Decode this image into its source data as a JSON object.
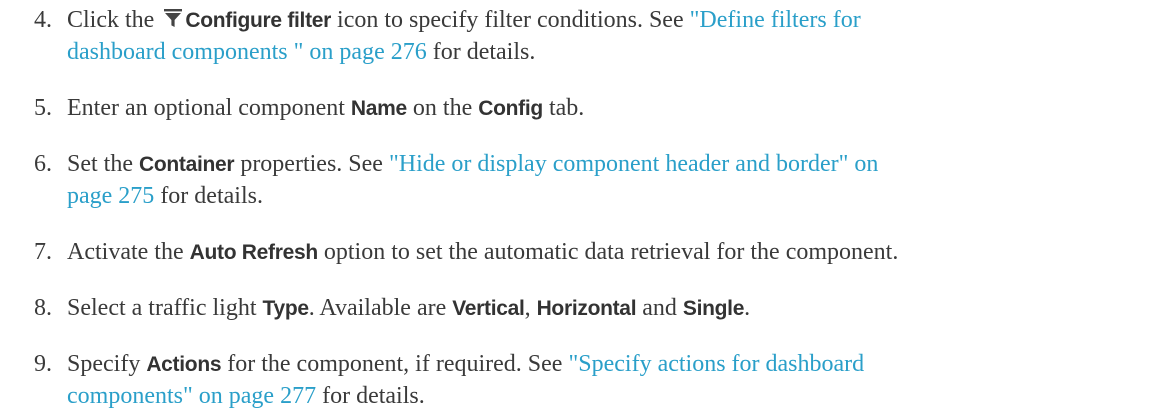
{
  "steps": [
    {
      "number": "4.",
      "pre": "Click the",
      "ui_label": "Configure filter",
      "mid": "icon to specify filter conditions. See",
      "link_part1": "\"Define filters for",
      "link_part2": "dashboard components \" on page 276",
      "post": "for details.",
      "icon": "filter-icon"
    },
    {
      "number": "5.",
      "pre": "Enter an optional component",
      "ui1": "Name",
      "mid": "on the",
      "ui2": "Config",
      "post": "tab."
    },
    {
      "number": "6.",
      "pre": "Set the",
      "ui1": "Container",
      "mid": "properties. See",
      "link_part1": "\"Hide or display component header and border\" on",
      "link_part2": "page 275",
      "post": "for details."
    },
    {
      "number": "7.",
      "pre": "Activate the",
      "ui1": "Auto Refresh",
      "post": "option to set the automatic data retrieval for the component."
    },
    {
      "number": "8.",
      "pre": "Select a traffic light",
      "ui1": "Type",
      "mid1": ". Available are",
      "ui2": "Vertical",
      "mid2": ",",
      "ui3": "Horizontal",
      "mid3": "and",
      "ui4": "Single",
      "post": "."
    },
    {
      "number": "9.",
      "pre": "Specify",
      "ui1": "Actions",
      "mid": "for the component, if required. See",
      "link_part1": "\"Specify actions for dashboard",
      "link_part2": "components\" on page 277",
      "post": "for details."
    }
  ],
  "colors": {
    "body_text": "#3a3a3a",
    "link": "#2a9fc9",
    "ui_label": "#333333"
  }
}
